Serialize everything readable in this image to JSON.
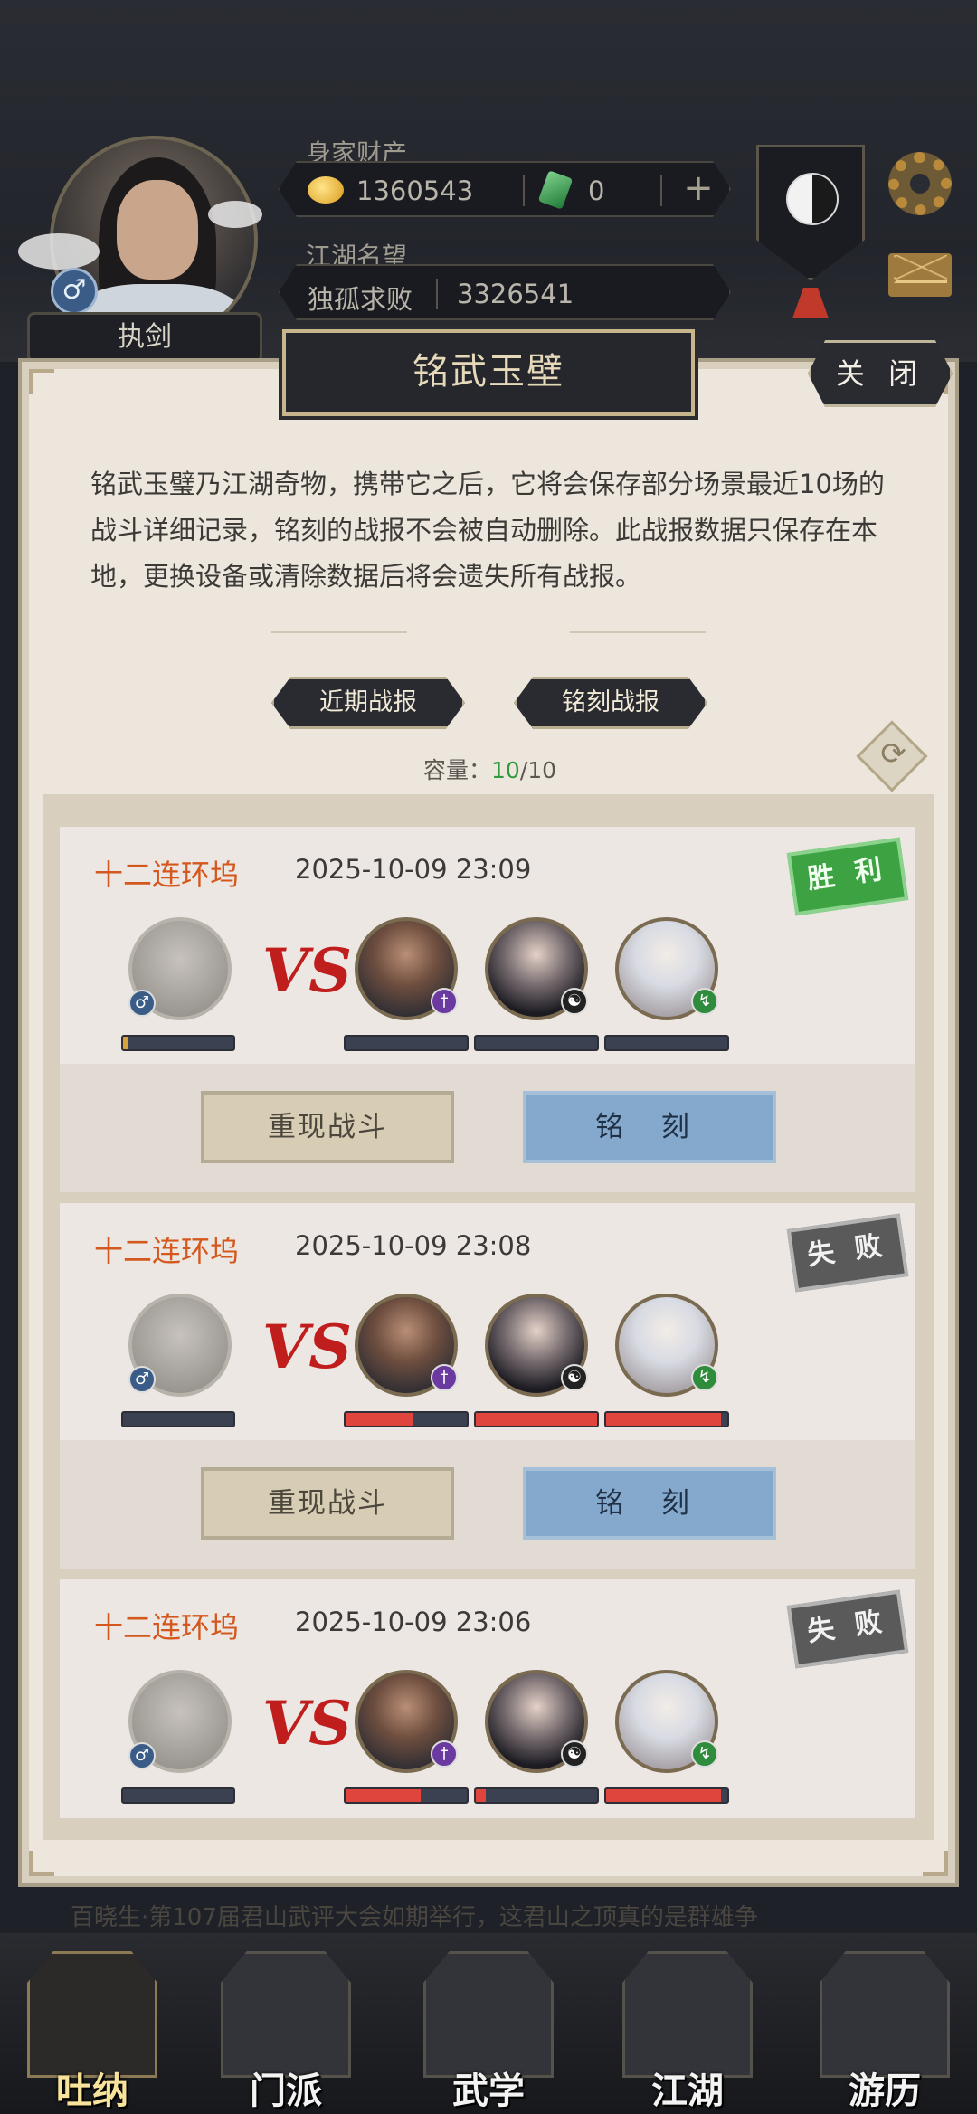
{
  "header": {
    "role_label": "执剑",
    "wealth_label": "身家财产",
    "coins": "1360543",
    "jade": "0",
    "fame_label": "江湖名望",
    "fame_title": "独孤求败",
    "fame_value": "3326541"
  },
  "modal": {
    "title": "铭武玉壁",
    "close_label": "关 闭",
    "description": "铭武玉璧乃江湖奇物，携带它之后，它将会保存部分场景最近10场的战斗详细记录，铭刻的战报不会被自动删除。此战报数据只保存在本地，更换设备或清除数据后将会遗失所有战报。",
    "tabs": [
      "近期战报",
      "铭刻战报"
    ],
    "capacity_label": "容量：",
    "capacity_used": "10",
    "capacity_total": "/10"
  },
  "battles": [
    {
      "location": "十二连环坞",
      "time": "2025-10-09 23:09",
      "result": "胜 利",
      "result_type": "win",
      "player_hp": 0.05,
      "enemy_hp": [
        0,
        0,
        0
      ],
      "replay_label": "重现战斗",
      "engrave_label": "铭 刻"
    },
    {
      "location": "十二连环坞",
      "time": "2025-10-09 23:08",
      "result": "失 败",
      "result_type": "lose",
      "player_hp": 0,
      "enemy_hp": [
        0.56,
        1.0,
        0.95
      ],
      "replay_label": "重现战斗",
      "engrave_label": "铭 刻"
    },
    {
      "location": "十二连环坞",
      "time": "2025-10-09 23:06",
      "result": "失 败",
      "result_type": "lose",
      "player_hp": 0,
      "enemy_hp": [
        0.62,
        0.08,
        0.95
      ]
    }
  ],
  "news": {
    "line1": "百晓生·第107届君山武评大会如期举行，这君山之顶真的是群雄争",
    "hl": "君山武评大会"
  },
  "nav": [
    "吐纳",
    "门派",
    "武学",
    "江湖",
    "游历"
  ]
}
